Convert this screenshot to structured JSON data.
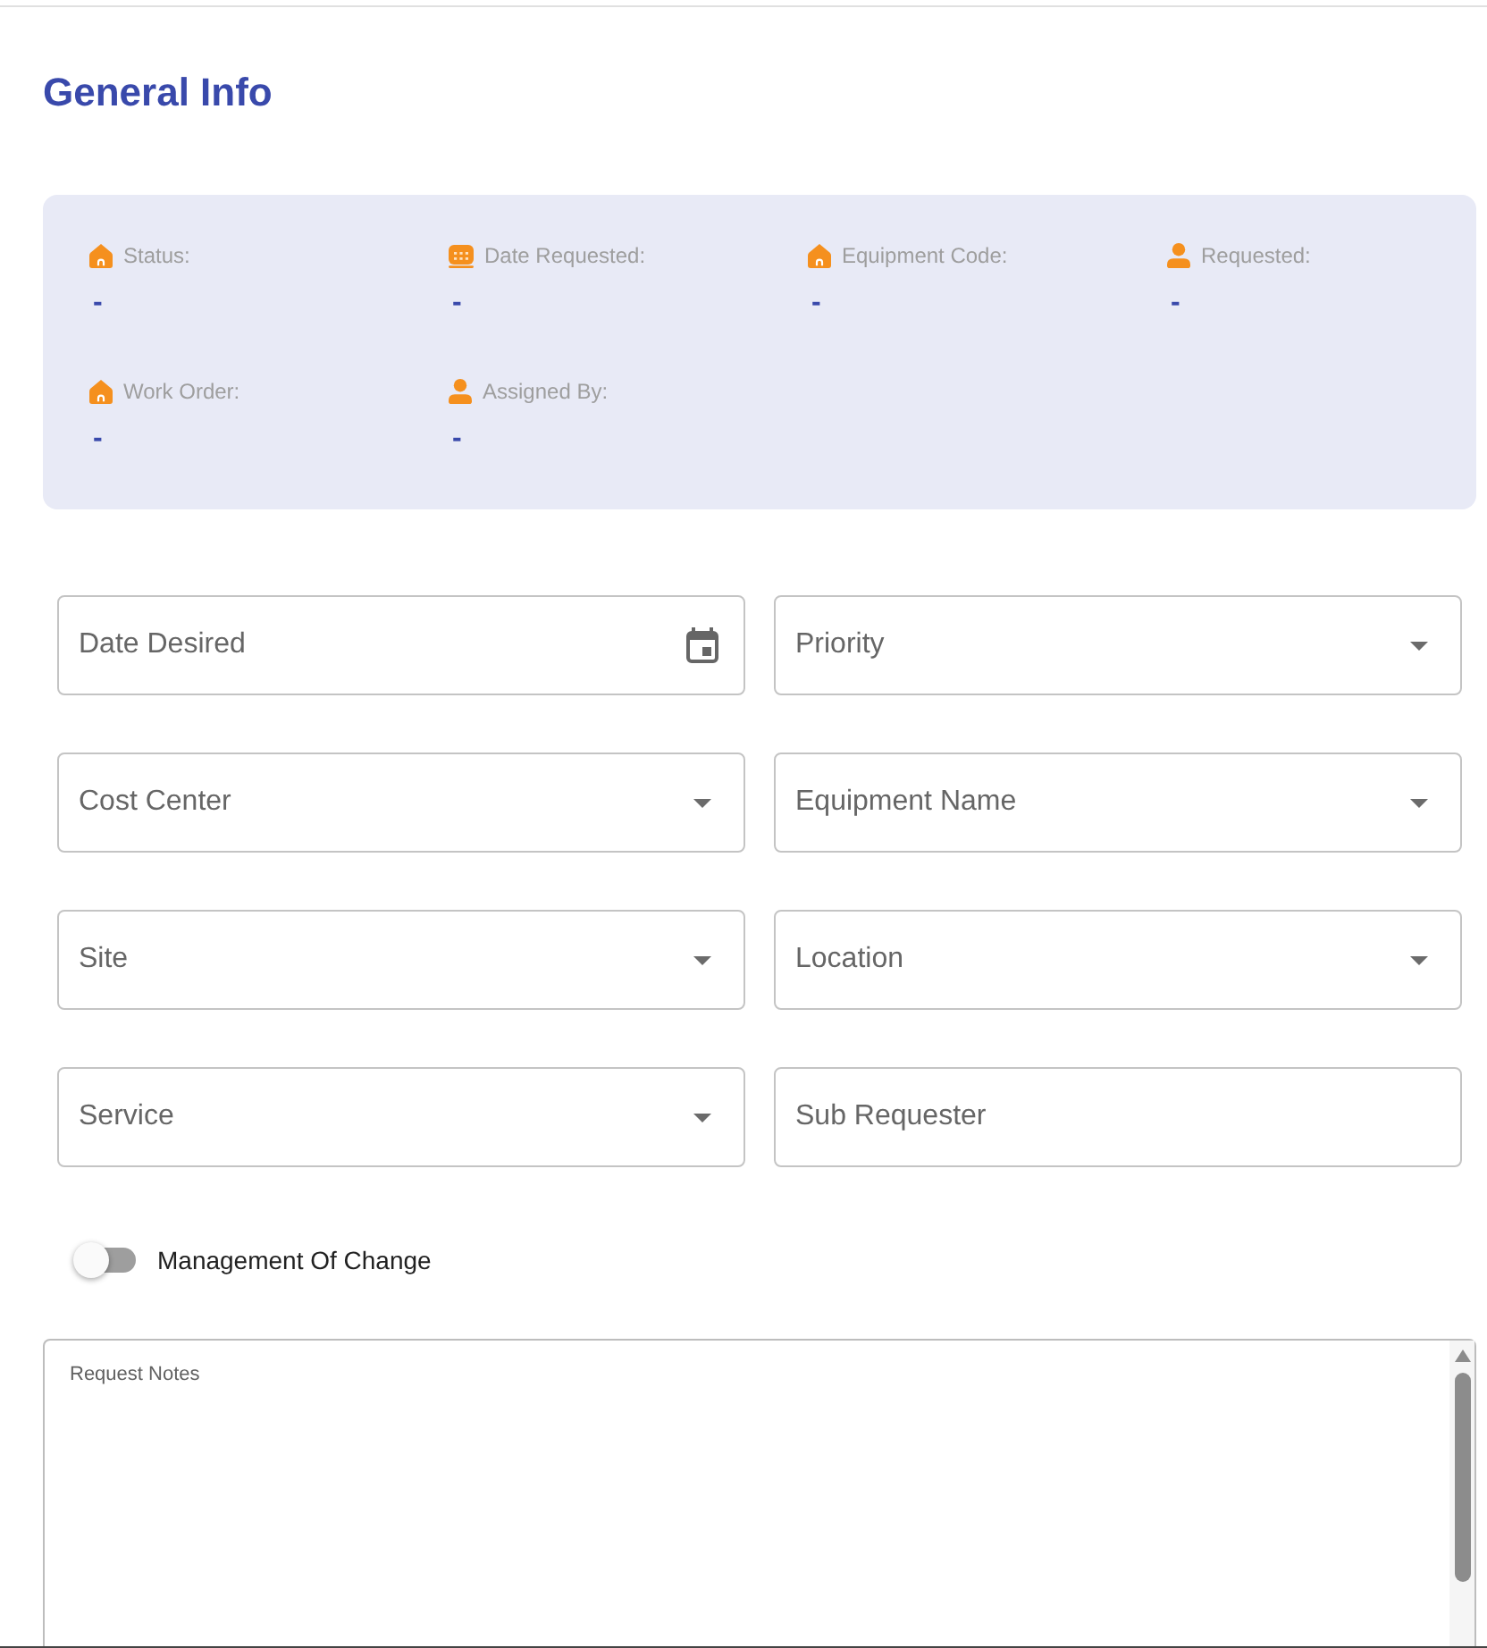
{
  "title": "General Info",
  "info": [
    {
      "kind": "home",
      "label": "Status:",
      "value": "-"
    },
    {
      "kind": "calendar",
      "label": "Date Requested:",
      "value": "-"
    },
    {
      "kind": "home",
      "label": "Equipment Code:",
      "value": "-"
    },
    {
      "kind": "person",
      "label": "Requested:",
      "value": "-"
    },
    {
      "kind": "home",
      "label": "Work Order:",
      "value": "-"
    },
    {
      "kind": "person",
      "label": "Assigned By:",
      "value": "-"
    }
  ],
  "fields": [
    {
      "kind": "date",
      "label": "Date Desired"
    },
    {
      "kind": "select",
      "label": "Priority"
    },
    {
      "kind": "select",
      "label": "Cost Center"
    },
    {
      "kind": "select",
      "label": "Equipment Name"
    },
    {
      "kind": "select",
      "label": "Site"
    },
    {
      "kind": "select",
      "label": "Location"
    },
    {
      "kind": "select",
      "label": "Service"
    },
    {
      "kind": "text",
      "label": "Sub Requester"
    }
  ],
  "toggle": {
    "label": "Management Of Change",
    "on": false
  },
  "notes": {
    "label": "Request Notes"
  }
}
